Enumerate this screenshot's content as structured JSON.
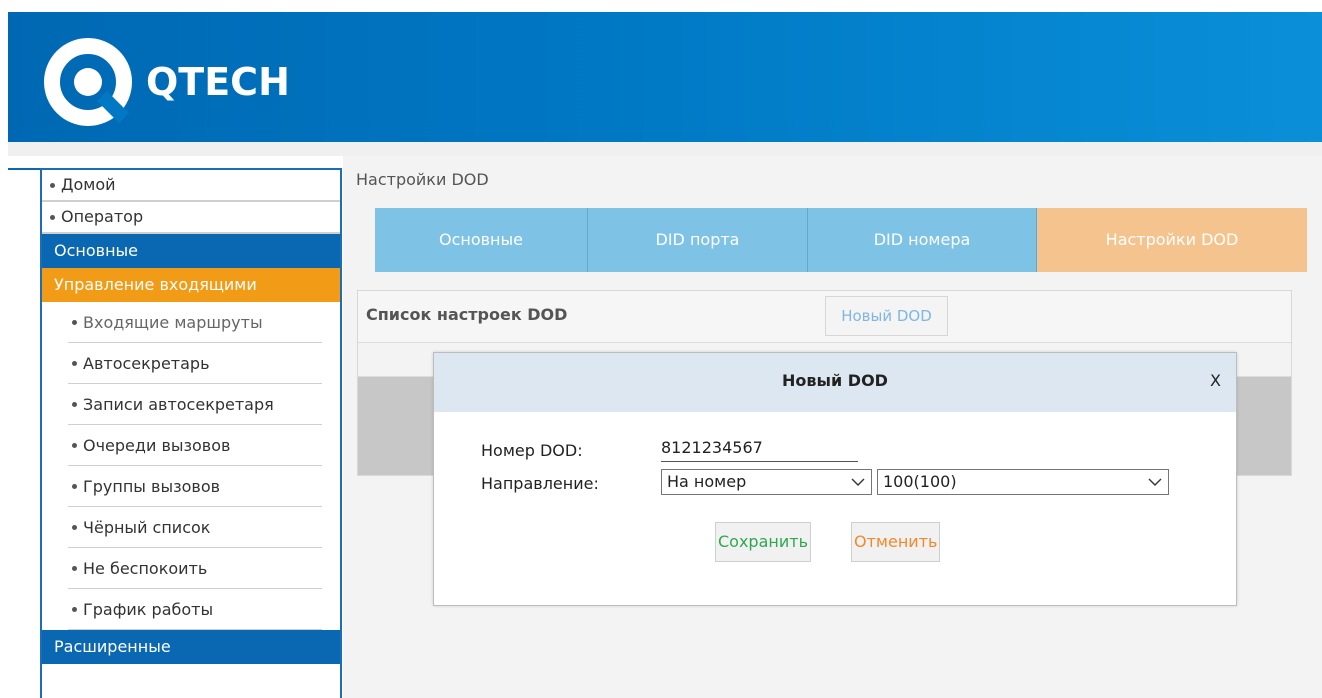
{
  "brand": {
    "name": "QTECH",
    "logo_icon": "qtech-logo-icon",
    "colors": {
      "header": "#0078c4",
      "nav_blue": "#0a67b1",
      "nav_active": "#f29b16",
      "tab": "#7ec3e6",
      "tab_active": "#f5c48e"
    }
  },
  "sidebar": {
    "top_items": [
      {
        "label": "Домой"
      },
      {
        "label": "Оператор"
      }
    ],
    "sections": {
      "basic": "Основные",
      "incoming": "Управление входящими",
      "advanced": "Расширенные"
    },
    "sub_items": [
      {
        "label": "Входящие маршруты"
      },
      {
        "label": "Автосекретарь"
      },
      {
        "label": "Записи автосекретаря"
      },
      {
        "label": "Очереди вызовов"
      },
      {
        "label": "Группы вызовов"
      },
      {
        "label": "Чёрный список"
      },
      {
        "label": "Не беспокоить"
      },
      {
        "label": "График работы"
      }
    ]
  },
  "breadcrumb": "Настройки DOD",
  "tabs": [
    {
      "label": "Основные"
    },
    {
      "label": "DID порта"
    },
    {
      "label": "DID номера"
    },
    {
      "label": "Настройки DOD",
      "active": true
    }
  ],
  "panel": {
    "title": "Список настроек DOD",
    "new_button": "Новый DOD"
  },
  "modal": {
    "title": "Новый DOD",
    "close": "X",
    "dod_number_label": "Номер DOD:",
    "dod_number_value": "8121234567",
    "direction_label": "Направление:",
    "direction_type": "На номер",
    "direction_target": "100(100)",
    "save": "Сохранить",
    "cancel": "Отменить"
  }
}
